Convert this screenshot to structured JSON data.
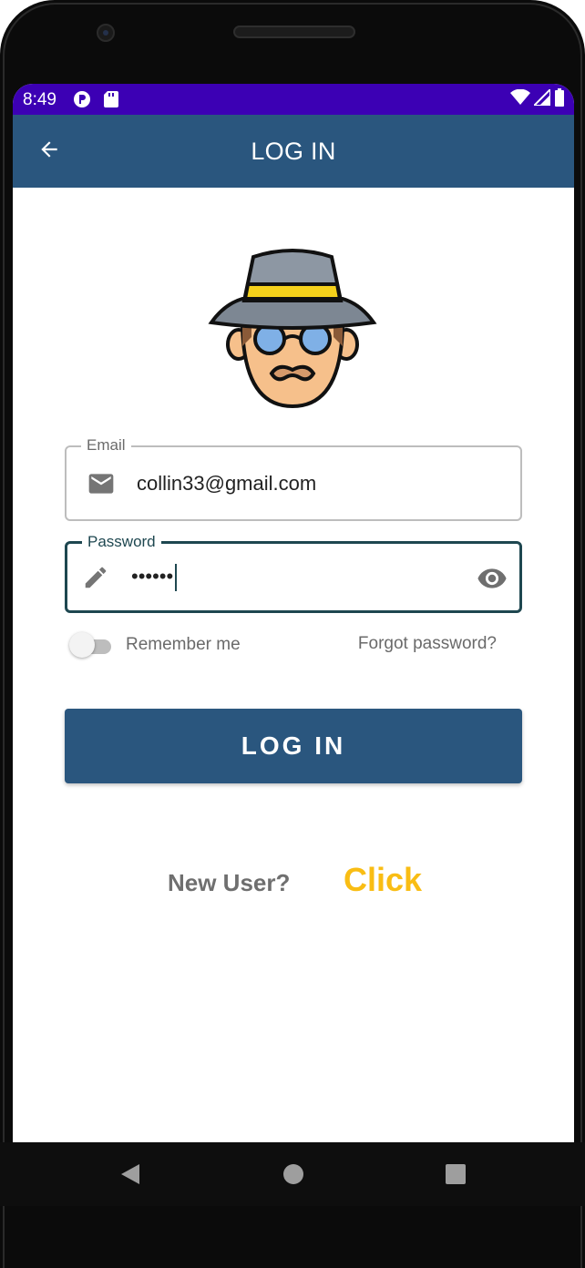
{
  "status_bar": {
    "time": "8:49",
    "left_icons": [
      "notification-icon",
      "sd-card-icon"
    ],
    "right_icons": [
      "wifi-icon",
      "cell-signal-icon",
      "battery-icon"
    ],
    "background": "#3c00b4"
  },
  "app_bar": {
    "title": "LOG IN",
    "back_icon": "arrow-back-icon",
    "background": "#2a567e"
  },
  "avatar": {
    "icon": "detective-avatar-icon"
  },
  "email_field": {
    "label": "Email",
    "value": "collin33@gmail.com",
    "icon": "mail-icon"
  },
  "password_field": {
    "label": "Password",
    "value": "••••••",
    "icon": "pencil-icon",
    "toggle_icon": "eye-icon"
  },
  "remember": {
    "label": "Remember me",
    "checked": false
  },
  "forgot_password": "Forgot password?",
  "login_button": "LOG IN",
  "signup": {
    "prompt": "New User?",
    "link": "Click",
    "link_color": "#f9bd14"
  },
  "nav_bar": {
    "items": [
      "back-nav-icon",
      "home-nav-icon",
      "recents-nav-icon"
    ]
  }
}
